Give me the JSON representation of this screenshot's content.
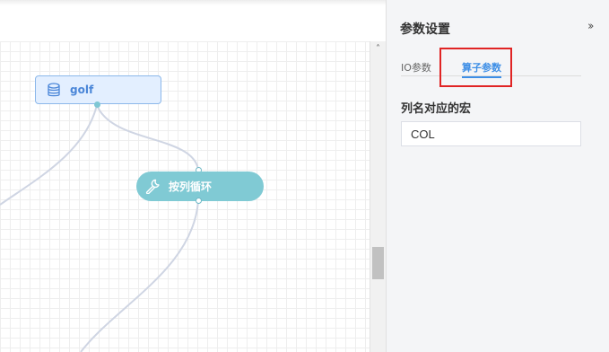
{
  "canvas": {
    "nodes": {
      "dataset": {
        "label": "golf",
        "icon": "database-icon"
      },
      "operator": {
        "label": "按列循环",
        "icon": "wrench-icon"
      }
    }
  },
  "panel": {
    "title": "参数设置",
    "collapse_icon": "double-chevron-right-icon",
    "tabs": [
      {
        "label": "IO参数",
        "active": false
      },
      {
        "label": "算子参数",
        "active": true
      }
    ],
    "field": {
      "label": "列名对应的宏",
      "value": "COL"
    }
  },
  "colors": {
    "dataset_node_bg": "#e3efff",
    "dataset_node_border": "#8cb8ea",
    "operator_node_bg": "#80cad4",
    "active_tab": "#3d8ee6",
    "highlight": "#e02424"
  }
}
